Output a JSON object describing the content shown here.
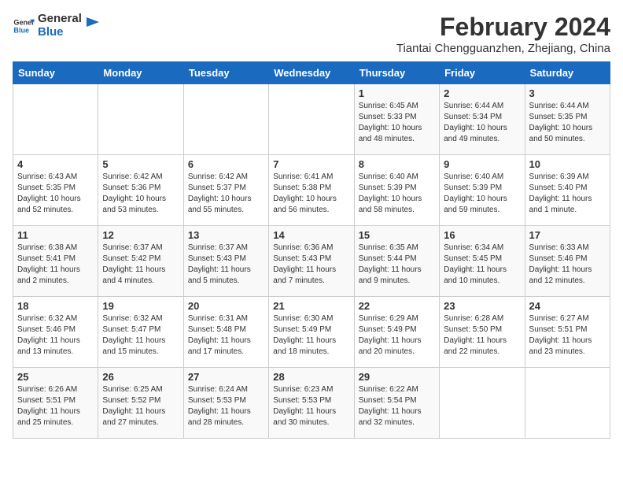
{
  "logo": {
    "line1": "General",
    "line2": "Blue"
  },
  "title": "February 2024",
  "subtitle": "Tiantai Chengguanzhen, Zhejiang, China",
  "days_of_week": [
    "Sunday",
    "Monday",
    "Tuesday",
    "Wednesday",
    "Thursday",
    "Friday",
    "Saturday"
  ],
  "weeks": [
    [
      {
        "day": "",
        "info": ""
      },
      {
        "day": "",
        "info": ""
      },
      {
        "day": "",
        "info": ""
      },
      {
        "day": "",
        "info": ""
      },
      {
        "day": "1",
        "info": "Sunrise: 6:45 AM\nSunset: 5:33 PM\nDaylight: 10 hours\nand 48 minutes."
      },
      {
        "day": "2",
        "info": "Sunrise: 6:44 AM\nSunset: 5:34 PM\nDaylight: 10 hours\nand 49 minutes."
      },
      {
        "day": "3",
        "info": "Sunrise: 6:44 AM\nSunset: 5:35 PM\nDaylight: 10 hours\nand 50 minutes."
      }
    ],
    [
      {
        "day": "4",
        "info": "Sunrise: 6:43 AM\nSunset: 5:35 PM\nDaylight: 10 hours\nand 52 minutes."
      },
      {
        "day": "5",
        "info": "Sunrise: 6:42 AM\nSunset: 5:36 PM\nDaylight: 10 hours\nand 53 minutes."
      },
      {
        "day": "6",
        "info": "Sunrise: 6:42 AM\nSunset: 5:37 PM\nDaylight: 10 hours\nand 55 minutes."
      },
      {
        "day": "7",
        "info": "Sunrise: 6:41 AM\nSunset: 5:38 PM\nDaylight: 10 hours\nand 56 minutes."
      },
      {
        "day": "8",
        "info": "Sunrise: 6:40 AM\nSunset: 5:39 PM\nDaylight: 10 hours\nand 58 minutes."
      },
      {
        "day": "9",
        "info": "Sunrise: 6:40 AM\nSunset: 5:39 PM\nDaylight: 10 hours\nand 59 minutes."
      },
      {
        "day": "10",
        "info": "Sunrise: 6:39 AM\nSunset: 5:40 PM\nDaylight: 11 hours\nand 1 minute."
      }
    ],
    [
      {
        "day": "11",
        "info": "Sunrise: 6:38 AM\nSunset: 5:41 PM\nDaylight: 11 hours\nand 2 minutes."
      },
      {
        "day": "12",
        "info": "Sunrise: 6:37 AM\nSunset: 5:42 PM\nDaylight: 11 hours\nand 4 minutes."
      },
      {
        "day": "13",
        "info": "Sunrise: 6:37 AM\nSunset: 5:43 PM\nDaylight: 11 hours\nand 5 minutes."
      },
      {
        "day": "14",
        "info": "Sunrise: 6:36 AM\nSunset: 5:43 PM\nDaylight: 11 hours\nand 7 minutes."
      },
      {
        "day": "15",
        "info": "Sunrise: 6:35 AM\nSunset: 5:44 PM\nDaylight: 11 hours\nand 9 minutes."
      },
      {
        "day": "16",
        "info": "Sunrise: 6:34 AM\nSunset: 5:45 PM\nDaylight: 11 hours\nand 10 minutes."
      },
      {
        "day": "17",
        "info": "Sunrise: 6:33 AM\nSunset: 5:46 PM\nDaylight: 11 hours\nand 12 minutes."
      }
    ],
    [
      {
        "day": "18",
        "info": "Sunrise: 6:32 AM\nSunset: 5:46 PM\nDaylight: 11 hours\nand 13 minutes."
      },
      {
        "day": "19",
        "info": "Sunrise: 6:32 AM\nSunset: 5:47 PM\nDaylight: 11 hours\nand 15 minutes."
      },
      {
        "day": "20",
        "info": "Sunrise: 6:31 AM\nSunset: 5:48 PM\nDaylight: 11 hours\nand 17 minutes."
      },
      {
        "day": "21",
        "info": "Sunrise: 6:30 AM\nSunset: 5:49 PM\nDaylight: 11 hours\nand 18 minutes."
      },
      {
        "day": "22",
        "info": "Sunrise: 6:29 AM\nSunset: 5:49 PM\nDaylight: 11 hours\nand 20 minutes."
      },
      {
        "day": "23",
        "info": "Sunrise: 6:28 AM\nSunset: 5:50 PM\nDaylight: 11 hours\nand 22 minutes."
      },
      {
        "day": "24",
        "info": "Sunrise: 6:27 AM\nSunset: 5:51 PM\nDaylight: 11 hours\nand 23 minutes."
      }
    ],
    [
      {
        "day": "25",
        "info": "Sunrise: 6:26 AM\nSunset: 5:51 PM\nDaylight: 11 hours\nand 25 minutes."
      },
      {
        "day": "26",
        "info": "Sunrise: 6:25 AM\nSunset: 5:52 PM\nDaylight: 11 hours\nand 27 minutes."
      },
      {
        "day": "27",
        "info": "Sunrise: 6:24 AM\nSunset: 5:53 PM\nDaylight: 11 hours\nand 28 minutes."
      },
      {
        "day": "28",
        "info": "Sunrise: 6:23 AM\nSunset: 5:53 PM\nDaylight: 11 hours\nand 30 minutes."
      },
      {
        "day": "29",
        "info": "Sunrise: 6:22 AM\nSunset: 5:54 PM\nDaylight: 11 hours\nand 32 minutes."
      },
      {
        "day": "",
        "info": ""
      },
      {
        "day": "",
        "info": ""
      }
    ]
  ]
}
